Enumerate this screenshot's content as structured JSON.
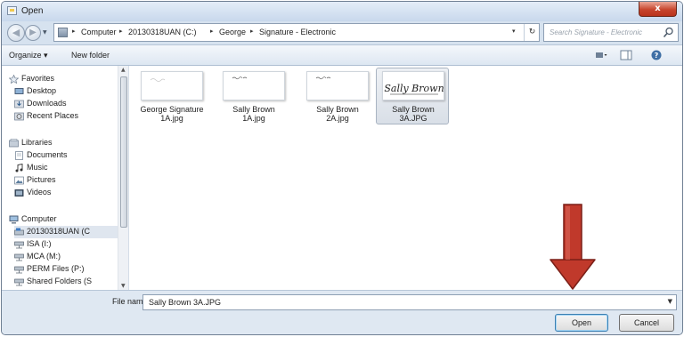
{
  "window": {
    "title": "Open",
    "close_glyph": "x"
  },
  "address": {
    "crumbs": [
      "Computer",
      "20130318UAN (C:)",
      "George",
      "Signature - Electronic"
    ],
    "separator": "▸",
    "dropdown_glyph": "▾",
    "refresh_glyph": "↻"
  },
  "search": {
    "placeholder": "Search Signature - Electronic",
    "icon": "search-icon"
  },
  "toolbar": {
    "organize_label": "Organize ▾",
    "new_folder_label": "New folder"
  },
  "nav_tree": {
    "favorites": {
      "label": "Favorites",
      "items": [
        "Desktop",
        "Downloads",
        "Recent Places"
      ]
    },
    "libraries": {
      "label": "Libraries",
      "items": [
        "Documents",
        "Music",
        "Pictures",
        "Videos"
      ]
    },
    "computer": {
      "label": "Computer",
      "items": [
        "20130318UAN (C",
        "ISA (I:)",
        "MCA (M:)",
        "PERM Files (P:)",
        "Shared Folders (S"
      ]
    }
  },
  "files": [
    {
      "name_line1": "George Signature",
      "name_line2": "1A.jpg",
      "selected": false,
      "thumb_text": ""
    },
    {
      "name_line1": "Sally Brown",
      "name_line2": "1A.jpg",
      "selected": false,
      "thumb_text": ""
    },
    {
      "name_line1": "Sally Brown",
      "name_line2": "2A.jpg",
      "selected": false,
      "thumb_text": ""
    },
    {
      "name_line1": "Sally Brown",
      "name_line2": "3A.JPG",
      "selected": true,
      "thumb_text": "Sally Brown"
    }
  ],
  "footer": {
    "file_name_label": "File name:",
    "file_name_value": "Sally Brown 3A.JPG",
    "open_label": "Open",
    "cancel_label": "Cancel"
  },
  "annotation": {
    "arrow_color": "#c0392b",
    "points_to": "Open"
  },
  "colors": {
    "selection": "#dfe6ef",
    "window_frame": "#d6e2ef",
    "accent_blue": "#3c7fb1"
  }
}
